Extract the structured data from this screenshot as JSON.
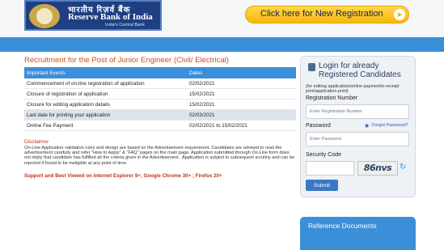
{
  "header": {
    "logo": {
      "hindi": "भारतीय रिज़र्व बैंक",
      "english": "Reserve Bank of India",
      "tagline": "India's Central Bank"
    },
    "new_registration_label": "Click here for New Registration"
  },
  "main": {
    "title": "Recruitment for the Post of Junior Engineer (Civil/ Electrical)",
    "table": {
      "headers": [
        "Important Events",
        "Dates"
      ],
      "rows": [
        {
          "event": "Commencement of on-line registration of application",
          "date": "02/02/2021"
        },
        {
          "event": "Closure of registration of application",
          "date": "15/02/2021"
        },
        {
          "event": "Closure for editing application details",
          "date": "15/02/2021"
        },
        {
          "event": "Last date for printing your application",
          "date": "02/03/2021"
        },
        {
          "event": "Online Fee Payment",
          "date": "02/02/2021 to 15/02/2021"
        }
      ]
    },
    "disclaimer_title": "Disclaimer",
    "disclaimer_text": "On-Line Application validation rules and design are based on the Advertisement requirement. Candidates are advised to read the advertisement carefully and refer \"How to Apply\" & \"FAQ\" pages on the main page. Application submitted through On-Line form does not imply that candidate has fulfilled all the criteria given in the Advertisement . Application is subject to subsequent scrutiny and can be rejected if found to be ineligible at any point of time.",
    "support_text": "Support and Best Viewed on Internet Explorer 9+; Google Chrome 30+ ; Firefox 20+"
  },
  "login": {
    "title": "Login for already Registered Candidates",
    "note": "(for editing application/online payment/e-receipt print/application print)",
    "registration_label": "Registration Number",
    "registration_placeholder": "Enter Registration Number",
    "password_label": "Password",
    "forgot_label": "Forgot Password?",
    "password_placeholder": "Enter Password",
    "security_label": "Security Code",
    "captcha_text": "86nvs",
    "submit_label": "Submit"
  },
  "reference": {
    "title": "Reference Documents"
  },
  "colors": {
    "primary_blue": "#3b8fd8",
    "title_orange": "#c8501e",
    "alert_red": "#c0301e",
    "button_yellow": "#f6b80c"
  },
  "icons": [
    "rbi-emblem-icon",
    "arrow-right-icon",
    "lock-icon",
    "help-icon",
    "refresh-icon"
  ]
}
